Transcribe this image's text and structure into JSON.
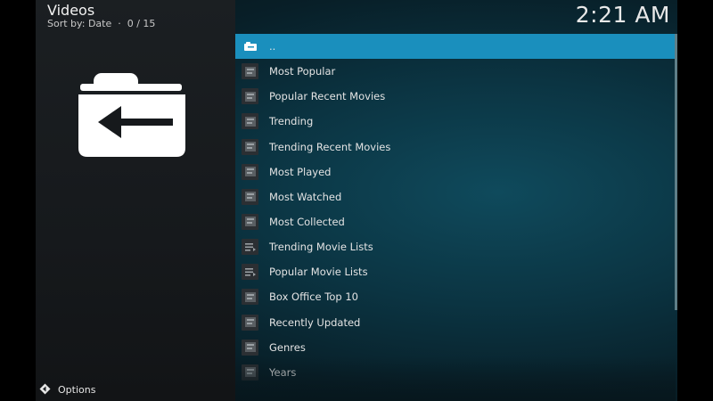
{
  "header": {
    "title": "Videos",
    "subtitle": "Sort by: Date  ·  0 / 15",
    "clock": "2:21 AM"
  },
  "sidebar": {
    "folder_icon": "folder-back-arrow-icon",
    "options_icon": "diamond-arrows-icon",
    "options_label": "Options"
  },
  "list": {
    "items": [
      {
        "label": "..",
        "icon": "folder-icon"
      },
      {
        "label": "Most Popular",
        "icon": "film-icon"
      },
      {
        "label": "Popular Recent Movies",
        "icon": "film-icon"
      },
      {
        "label": "Trending",
        "icon": "film-icon"
      },
      {
        "label": "Trending Recent Movies",
        "icon": "film-icon"
      },
      {
        "label": "Most Played",
        "icon": "film-icon"
      },
      {
        "label": "Most Watched",
        "icon": "film-icon"
      },
      {
        "label": "Most Collected",
        "icon": "film-icon"
      },
      {
        "label": "Trending Movie Lists",
        "icon": "list-icon"
      },
      {
        "label": "Popular Movie Lists",
        "icon": "list-icon"
      },
      {
        "label": "Box Office Top 10",
        "icon": "film-icon"
      },
      {
        "label": "Recently Updated",
        "icon": "film-icon"
      },
      {
        "label": "Genres",
        "icon": "film-icon"
      },
      {
        "label": "Years",
        "icon": "film-icon"
      }
    ]
  },
  "colors": {
    "accent": "#1a8fbd",
    "panel": "#1b1f22",
    "background": "#0b3442"
  }
}
